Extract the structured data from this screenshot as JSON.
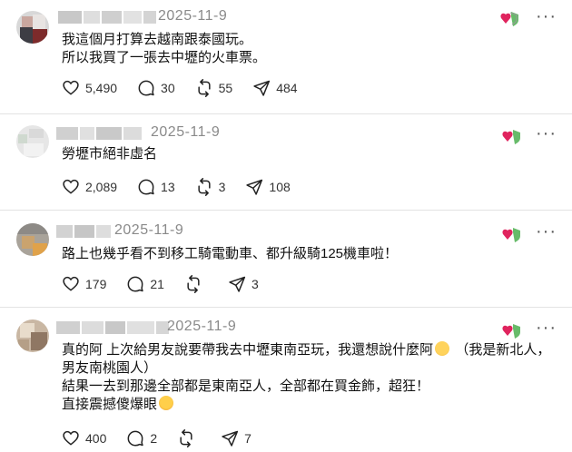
{
  "posts": [
    {
      "date": "2025-11-9",
      "lines": [
        "我這個月打算去越南跟泰國玩。",
        "所以我買了一張去中壢的火車票。"
      ],
      "likes": "5,490",
      "comments": "30",
      "reposts": "55",
      "shares": "484"
    },
    {
      "date": "2025-11-9",
      "lines": [
        "勞壢市絕非虛名"
      ],
      "likes": "2,089",
      "comments": "13",
      "reposts": "3",
      "shares": "108"
    },
    {
      "date": "2025-11-9",
      "lines": [
        "路上也幾乎看不到移工騎電動車、都升級騎125機車啦！"
      ],
      "likes": "179",
      "comments": "21",
      "reposts": "",
      "shares": "3"
    },
    {
      "date": "2025-11-9",
      "lines": [
        "真的阿 上次給男友說要帶我去中壢東南亞玩，我還想說什麼阿",
        "（我是新北人，",
        "男友南桃園人）",
        "結果一去到那邊全部都是東南亞人，全部都在買金飾，超狂！",
        "直接震撼傻爆眼"
      ],
      "likes": "400",
      "comments": "2",
      "reposts": "",
      "shares": "7"
    }
  ],
  "more_label": "···",
  "icons": {
    "like": "heart-icon",
    "comment": "comment-bubble-icon",
    "repost": "repost-icon",
    "share": "send-icon",
    "badge": "heart-shield-badge-icon"
  },
  "colors": {
    "badge_heart": "#e0245e",
    "badge_leaf": "#4caf50",
    "muted": "#8a8a8a"
  }
}
